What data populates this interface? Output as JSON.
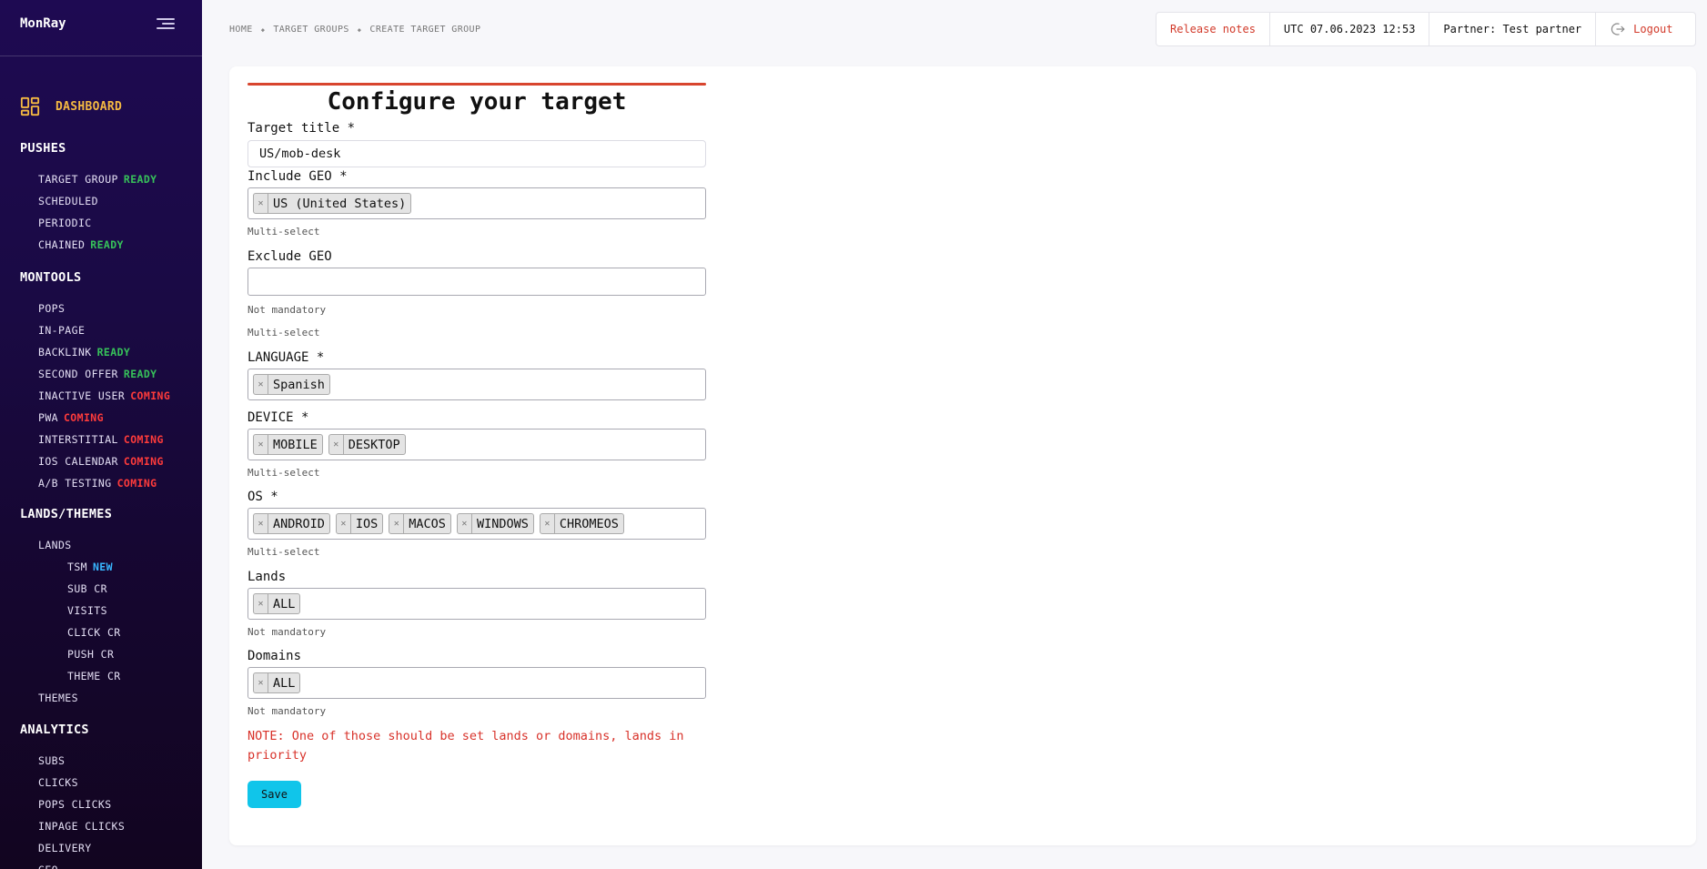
{
  "brand": "MonRay",
  "sidebar": {
    "dashboard": "DASHBOARD",
    "sections": [
      {
        "title": "PUSHES",
        "items": [
          {
            "label": "TARGET GROUP",
            "badge": "READY",
            "badge_type": "ready"
          },
          {
            "label": "SCHEDULED"
          },
          {
            "label": "PERIODIC"
          },
          {
            "label": "CHAINED",
            "badge": "READY",
            "badge_type": "ready"
          }
        ]
      },
      {
        "title": "MONTOOLS",
        "items": [
          {
            "label": "POPS"
          },
          {
            "label": "IN-PAGE"
          },
          {
            "label": "BACKLINK",
            "badge": "READY",
            "badge_type": "ready"
          },
          {
            "label": "SECOND OFFER",
            "badge": "READY",
            "badge_type": "ready"
          },
          {
            "label": "INACTIVE USER",
            "badge": "COMING",
            "badge_type": "coming"
          },
          {
            "label": "PWA",
            "badge": "COMING",
            "badge_type": "coming"
          },
          {
            "label": "INTERSTITIAL",
            "badge": "COMING",
            "badge_type": "coming"
          },
          {
            "label": "IOS CALENDAR",
            "badge": "COMING",
            "badge_type": "coming"
          },
          {
            "label": "A/B TESTING",
            "badge": "COMING",
            "badge_type": "coming"
          }
        ]
      },
      {
        "title": "LANDS/THEMES",
        "items": [
          {
            "label": "LANDS"
          },
          {
            "label": "TSM",
            "badge": "NEW",
            "badge_type": "new",
            "sub": true
          },
          {
            "label": "SUB CR",
            "sub": true
          },
          {
            "label": "VISITS",
            "sub": true
          },
          {
            "label": "CLICK CR",
            "sub": true
          },
          {
            "label": "PUSH CR",
            "sub": true
          },
          {
            "label": "THEME CR",
            "sub": true
          },
          {
            "label": "THEMES"
          }
        ]
      },
      {
        "title": "ANALYTICS",
        "items": [
          {
            "label": "SUBS"
          },
          {
            "label": "CLICKS"
          },
          {
            "label": "POPS CLICKS"
          },
          {
            "label": "INPAGE CLICKS"
          },
          {
            "label": "DELIVERY"
          },
          {
            "label": "GEO"
          }
        ]
      }
    ]
  },
  "breadcrumb": [
    "HOME",
    "TARGET GROUPS",
    "CREATE TARGET GROUP"
  ],
  "header": {
    "release_notes": "Release notes",
    "utc_time": "UTC 07.06.2023 12:53",
    "partner": "Partner: Test partner",
    "logout": "Logout"
  },
  "form": {
    "title": "Configure your target",
    "target_title_label": "Target title *",
    "target_title_value": "US/mob-desk",
    "include_geo_label": "Include GEO *",
    "include_geo_chips": [
      "US (United States)"
    ],
    "include_geo_hint": "Multi-select",
    "exclude_geo_label": "Exclude GEO",
    "exclude_geo_chips": [],
    "exclude_geo_hint1": "Not mandatory",
    "exclude_geo_hint2": "Multi-select",
    "language_label": "LANGUAGE *",
    "language_chips": [
      "Spanish"
    ],
    "device_label": "DEVICE *",
    "device_chips": [
      "MOBILE",
      "DESKTOP"
    ],
    "device_hint": "Multi-select",
    "os_label": "OS *",
    "os_chips": [
      "ANDROID",
      "IOS",
      "MACOS",
      "WINDOWS",
      "CHROMEOS"
    ],
    "os_hint": "Multi-select",
    "lands_label": "Lands",
    "lands_chips": [
      "ALL"
    ],
    "lands_hint": "Not mandatory",
    "domains_label": "Domains",
    "domains_chips": [
      "ALL"
    ],
    "domains_hint": "Not mandatory",
    "note": "NOTE: One of those should be set lands or domains, lands in priority",
    "save_label": "Save"
  },
  "colors": {
    "accent_orange": "#f5b942",
    "ready": "#37c25a",
    "coming": "#ff3b3b",
    "new": "#38b6ff",
    "danger": "#d23a2a",
    "save_button": "#10c5ea"
  }
}
